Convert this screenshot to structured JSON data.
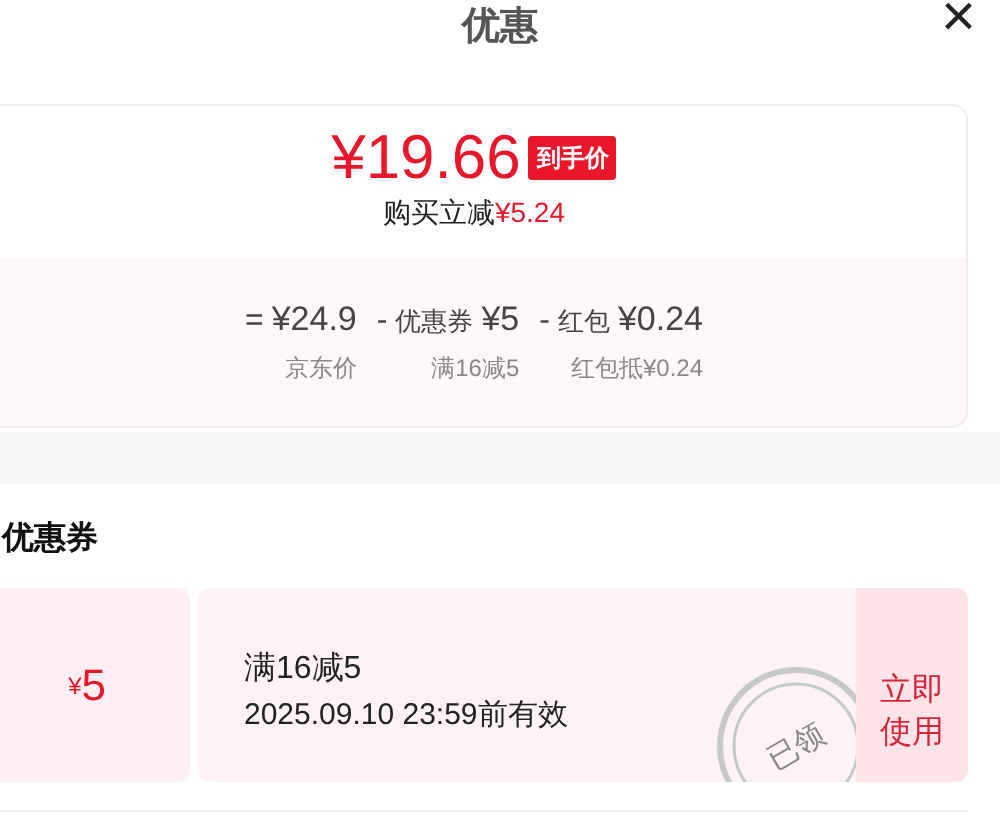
{
  "header": {
    "title": "优惠",
    "close": "×"
  },
  "price_card": {
    "price": "¥19.66",
    "tag": "到手价",
    "saving_label": "购买立减",
    "saving_amount": "¥5.24",
    "terms": [
      {
        "op": "=",
        "amount": "¥24.9",
        "caption": "京东价"
      },
      {
        "op": "-",
        "label": "优惠券",
        "amount": "¥5",
        "caption": "满16减5"
      },
      {
        "op": "-",
        "label": "红包",
        "amount": "¥0.24",
        "caption": "红包抵¥0.24"
      }
    ]
  },
  "coupons": {
    "heading": "优惠券",
    "items": [
      {
        "currency": "¥",
        "value": "5",
        "title": "满16减5",
        "validity": "2025.09.10 23:59前有效",
        "stamp": "已领",
        "claimed": true,
        "action": "立即使用"
      }
    ]
  }
}
